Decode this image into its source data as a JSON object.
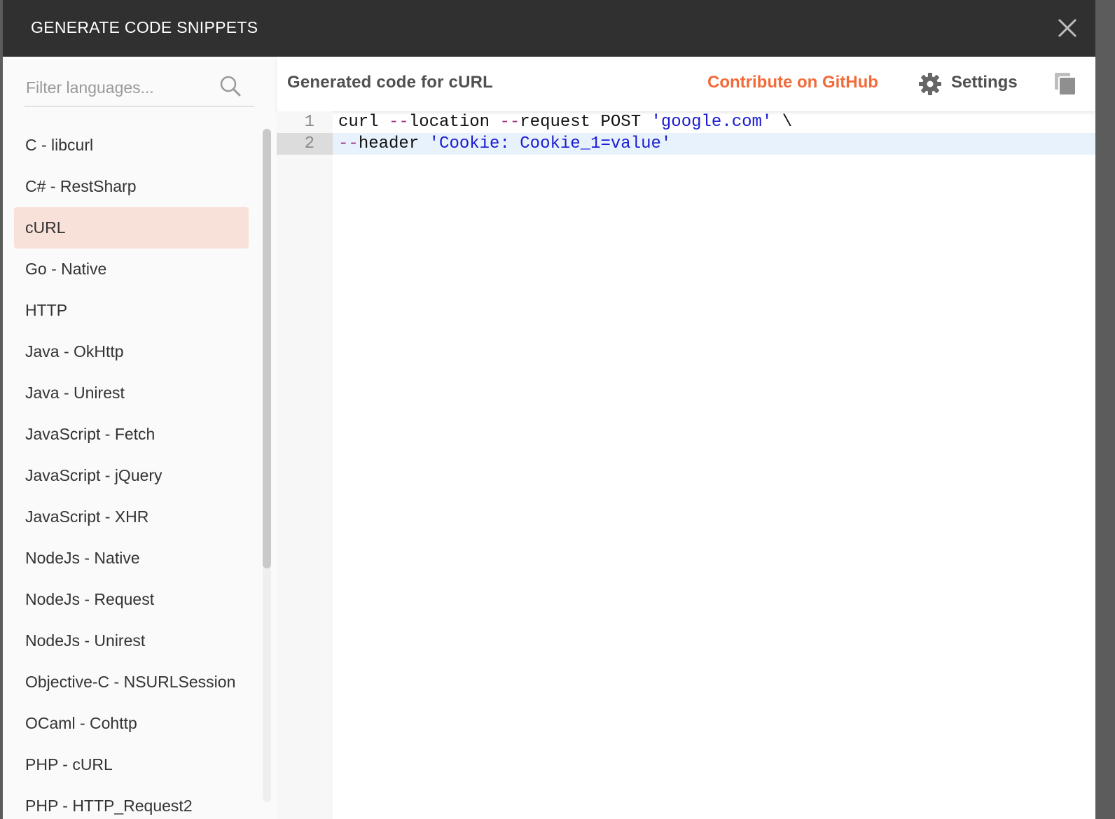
{
  "dialog": {
    "title": "GENERATE CODE SNIPPETS",
    "close_icon": "close-icon"
  },
  "sidebar": {
    "search": {
      "placeholder": "Filter languages...",
      "value": ""
    },
    "languages": [
      {
        "label": "C - libcurl",
        "selected": false
      },
      {
        "label": "C# - RestSharp",
        "selected": false
      },
      {
        "label": "cURL",
        "selected": true
      },
      {
        "label": "Go - Native",
        "selected": false
      },
      {
        "label": "HTTP",
        "selected": false
      },
      {
        "label": "Java - OkHttp",
        "selected": false
      },
      {
        "label": "Java - Unirest",
        "selected": false
      },
      {
        "label": "JavaScript - Fetch",
        "selected": false
      },
      {
        "label": "JavaScript - jQuery",
        "selected": false
      },
      {
        "label": "JavaScript - XHR",
        "selected": false
      },
      {
        "label": "NodeJs - Native",
        "selected": false
      },
      {
        "label": "NodeJs - Request",
        "selected": false
      },
      {
        "label": "NodeJs - Unirest",
        "selected": false
      },
      {
        "label": "Objective-C - NSURLSession",
        "selected": false
      },
      {
        "label": "OCaml - Cohttp",
        "selected": false
      },
      {
        "label": "PHP - cURL",
        "selected": false
      },
      {
        "label": "PHP - HTTP_Request2",
        "selected": false
      }
    ],
    "selected_color": "#f8e1d8"
  },
  "toolbar": {
    "title": "Generated code for cURL",
    "contribute_label": "Contribute on GitHub",
    "contribute_color": "#f26b3a",
    "settings_label": "Settings"
  },
  "editor": {
    "active_line": 2,
    "lines": [
      {
        "number": "1",
        "tokens": [
          {
            "text": "curl ",
            "type": "plain"
          },
          {
            "text": "--",
            "type": "op"
          },
          {
            "text": "location ",
            "type": "plain"
          },
          {
            "text": "--",
            "type": "op"
          },
          {
            "text": "request POST ",
            "type": "plain"
          },
          {
            "text": "'google.com'",
            "type": "str"
          },
          {
            "text": " \\",
            "type": "plain"
          }
        ]
      },
      {
        "number": "2",
        "tokens": [
          {
            "text": "--",
            "type": "op"
          },
          {
            "text": "header ",
            "type": "plain"
          },
          {
            "text": "'Cookie: Cookie_1=value'",
            "type": "str"
          }
        ]
      }
    ]
  }
}
